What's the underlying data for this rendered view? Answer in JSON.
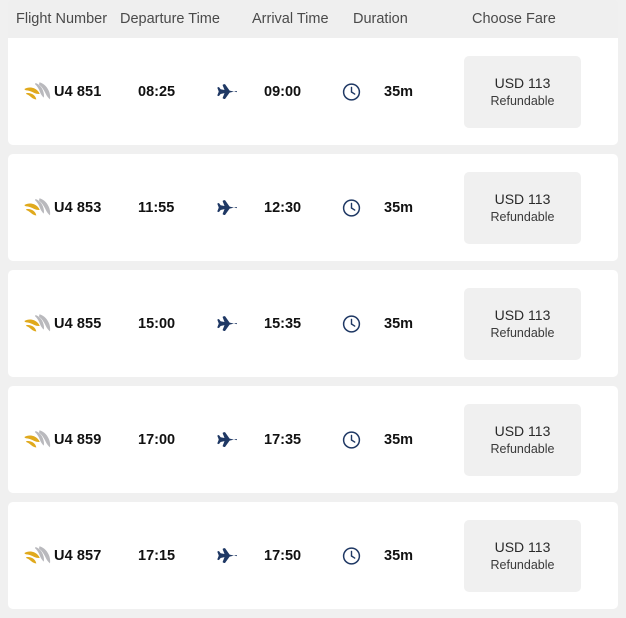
{
  "table": {
    "headers": {
      "flight_number": "Flight Number",
      "departure_time": "Departure Time",
      "arrival_time": "Arrival Time",
      "duration": "Duration",
      "choose_fare": "Choose Fare"
    }
  },
  "icons": {
    "airline_logo": "airline-logo-icon",
    "plane": "plane-icon",
    "clock": "clock-icon"
  },
  "colors": {
    "page_background": "#f0f0f0",
    "card_background": "#ffffff",
    "header_background": "#efefef",
    "icon_navy": "#1f3864",
    "logo_gold": "#e0a91c",
    "logo_gray": "#b9b9bd",
    "fare_button_background": "#f0f0f0",
    "text_primary": "#111111",
    "text_header": "#4a4a4a"
  },
  "flights": [
    {
      "flight_number": "U4 851",
      "departure_time": "08:25",
      "arrival_time": "09:00",
      "duration": "35m",
      "fare_price": "USD 113",
      "fare_type": "Refundable"
    },
    {
      "flight_number": "U4 853",
      "departure_time": "11:55",
      "arrival_time": "12:30",
      "duration": "35m",
      "fare_price": "USD 113",
      "fare_type": "Refundable"
    },
    {
      "flight_number": "U4 855",
      "departure_time": "15:00",
      "arrival_time": "15:35",
      "duration": "35m",
      "fare_price": "USD 113",
      "fare_type": "Refundable"
    },
    {
      "flight_number": "U4 859",
      "departure_time": "17:00",
      "arrival_time": "17:35",
      "duration": "35m",
      "fare_price": "USD 113",
      "fare_type": "Refundable"
    },
    {
      "flight_number": "U4 857",
      "departure_time": "17:15",
      "arrival_time": "17:50",
      "duration": "35m",
      "fare_price": "USD 113",
      "fare_type": "Refundable"
    }
  ]
}
